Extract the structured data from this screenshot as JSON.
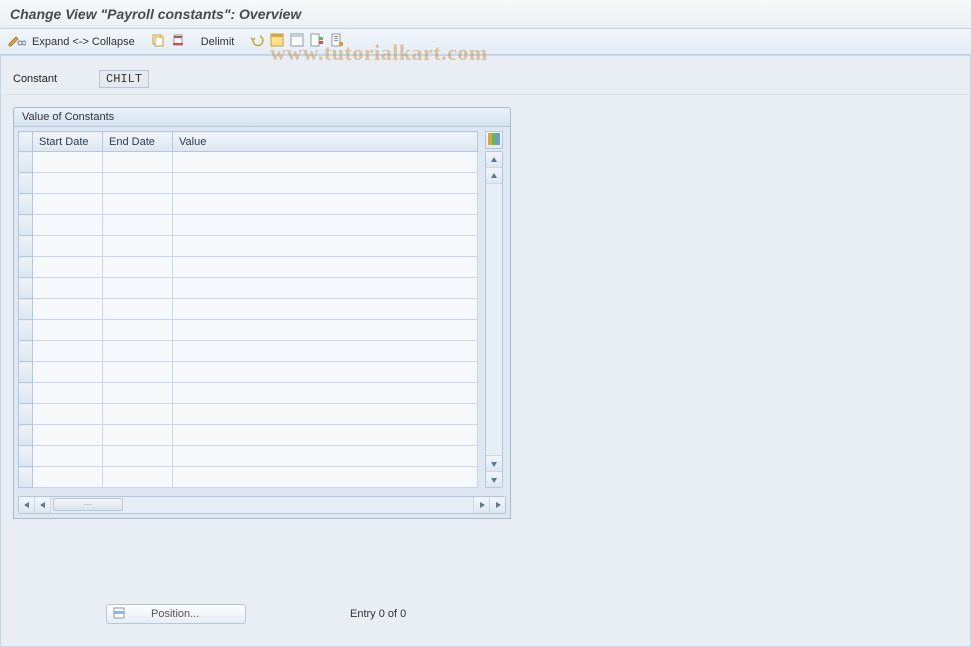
{
  "title": "Change View \"Payroll constants\": Overview",
  "toolbar": {
    "expand_collapse": "Expand <-> Collapse",
    "delimit": "Delimit"
  },
  "field": {
    "constant_label": "Constant",
    "constant_value": "CHILT"
  },
  "panel": {
    "title": "Value of Constants",
    "columns": {
      "start_date": "Start Date",
      "end_date": "End Date",
      "value": "Value"
    },
    "rows": [
      {
        "start_date": "",
        "end_date": "",
        "value": ""
      },
      {
        "start_date": "",
        "end_date": "",
        "value": ""
      },
      {
        "start_date": "",
        "end_date": "",
        "value": ""
      },
      {
        "start_date": "",
        "end_date": "",
        "value": ""
      },
      {
        "start_date": "",
        "end_date": "",
        "value": ""
      },
      {
        "start_date": "",
        "end_date": "",
        "value": ""
      },
      {
        "start_date": "",
        "end_date": "",
        "value": ""
      },
      {
        "start_date": "",
        "end_date": "",
        "value": ""
      },
      {
        "start_date": "",
        "end_date": "",
        "value": ""
      },
      {
        "start_date": "",
        "end_date": "",
        "value": ""
      },
      {
        "start_date": "",
        "end_date": "",
        "value": ""
      },
      {
        "start_date": "",
        "end_date": "",
        "value": ""
      },
      {
        "start_date": "",
        "end_date": "",
        "value": ""
      },
      {
        "start_date": "",
        "end_date": "",
        "value": ""
      },
      {
        "start_date": "",
        "end_date": "",
        "value": ""
      },
      {
        "start_date": "",
        "end_date": "",
        "value": ""
      }
    ]
  },
  "footer": {
    "position_label": "Position...",
    "entry_text": "Entry 0 of 0"
  },
  "watermark": "www.tutorialkart.com"
}
